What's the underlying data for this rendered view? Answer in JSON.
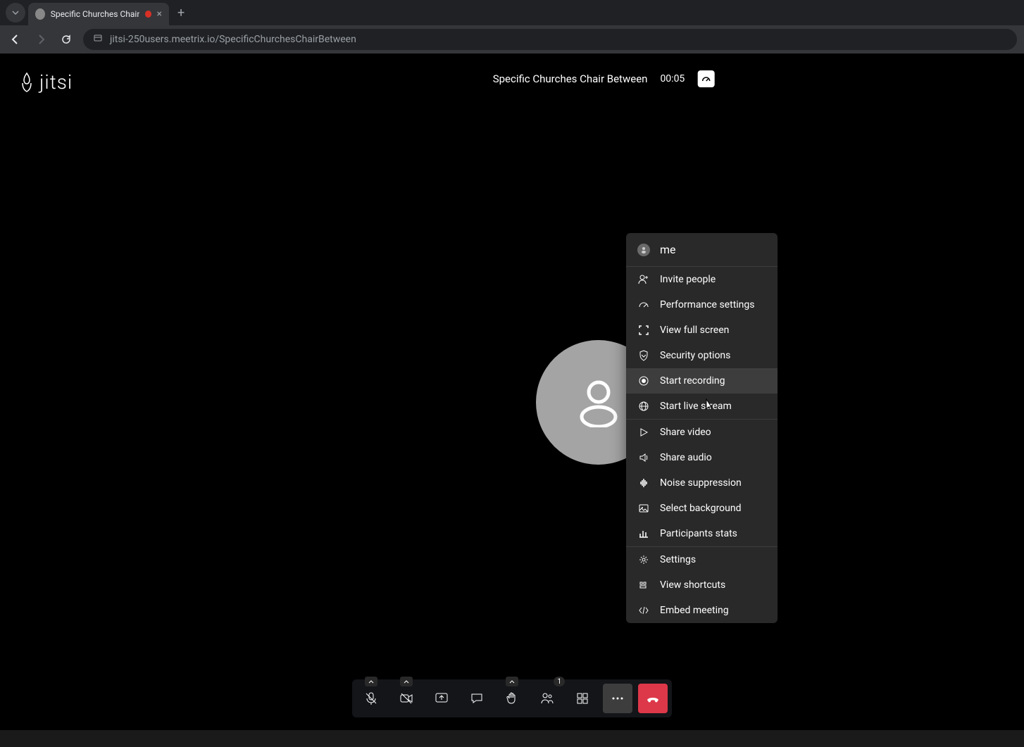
{
  "browser": {
    "tab_title": "Specific Churches Chair Bet",
    "url": "jitsi-250users.meetrix.io/SpecificChurchesChairBetween"
  },
  "header": {
    "logo_text": "jitsi",
    "room_name": "Specific Churches Chair Between",
    "timer": "00:05"
  },
  "menu": {
    "user_label": "me",
    "items": {
      "invite": "Invite people",
      "performance": "Performance settings",
      "fullscreen": "View full screen",
      "security": "Security options",
      "recording": "Start recording",
      "livestream": "Start live stream",
      "share_video": "Share video",
      "share_audio": "Share audio",
      "noise": "Noise suppression",
      "background": "Select background",
      "stats": "Participants stats",
      "settings": "Settings",
      "shortcuts": "View shortcuts",
      "embed": "Embed meeting"
    }
  },
  "toolbar": {
    "participants_count": "1"
  }
}
